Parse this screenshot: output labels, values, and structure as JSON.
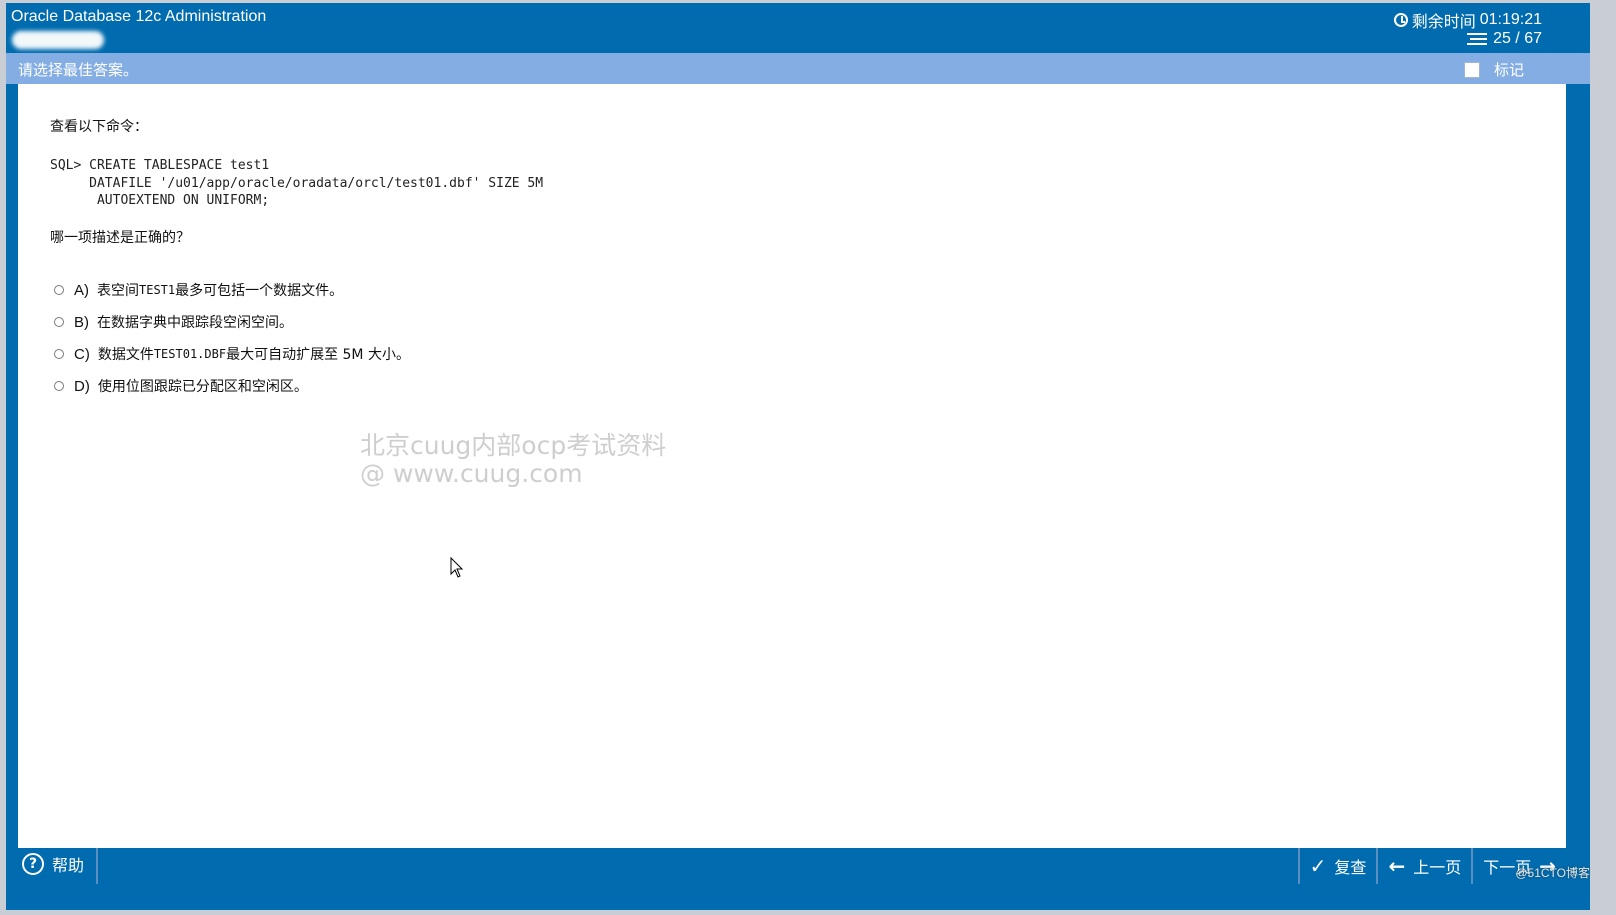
{
  "titlebar": {
    "app_title": "Oracle Database 12c Administration",
    "timer_label": "剩余时间",
    "timer_value": "01:19:21",
    "progress": "25 / 67"
  },
  "instruction_bar": {
    "text": "请选择最佳答案。",
    "mark_label": "标记"
  },
  "question": {
    "prompt": "查看以下命令：",
    "code_lines": [
      "SQL> CREATE TABLESPACE test1",
      "     DATAFILE '/u01/app/oracle/oradata/orcl/test01.dbf' SIZE 5M",
      "      AUTOEXTEND ON UNIFORM;"
    ],
    "question_text": "哪一项描述是正确的？",
    "options": [
      {
        "letter": "A)",
        "pre": "表空间 ",
        "code": "TEST1",
        "post": " 最多可包括一个数据文件。"
      },
      {
        "letter": "B)",
        "pre": "在数据字典中跟踪段空闲空间。",
        "code": "",
        "post": ""
      },
      {
        "letter": "C)",
        "pre": "数据文件 ",
        "code": "TEST01.DBF",
        "post": " 最大可自动扩展至 5M 大小。"
      },
      {
        "letter": "D)",
        "pre": "使用位图跟踪已分配区和空闲区。",
        "code": "",
        "post": ""
      }
    ]
  },
  "watermark": {
    "line1": "北京cuug内部ocp考试资料",
    "line2": "@ www.cuug.com"
  },
  "footer": {
    "help_label": "帮助",
    "review_label": "复查",
    "prev_label": "上一页",
    "next_label": "下一页",
    "site_mark": "@51CTO博客"
  },
  "icons": {
    "timer": "clock-icon",
    "progress": "list-icon",
    "help": "help-icon",
    "review": "checkmark-icon",
    "prev": "arrow-left-icon",
    "next": "arrow-right-icon"
  },
  "colors": {
    "frame": "#006bae",
    "instruction_bar": "#84aee3",
    "content_bg": "#ffffff"
  }
}
